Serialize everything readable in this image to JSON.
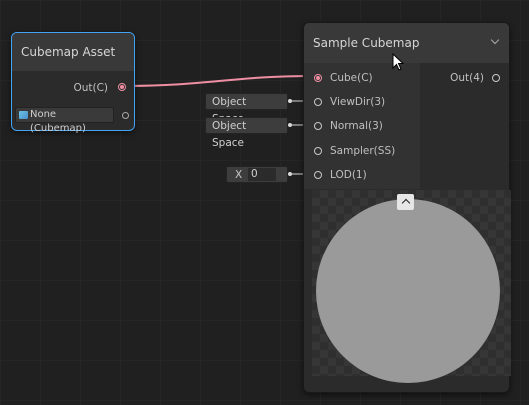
{
  "cubemap_asset_node": {
    "title": "Cubemap Asset",
    "output_label": "Out(C)",
    "field_value": "None (Cubemap)"
  },
  "sample_cubemap_node": {
    "title": "Sample Cubemap",
    "inputs": [
      "Cube(C)",
      "ViewDir(3)",
      "Normal(3)",
      "Sampler(SS)",
      "LOD(1)"
    ],
    "output_label": "Out(4)"
  },
  "inline_inputs": {
    "viewdir_value": "Object Space",
    "normal_value": "Object Space",
    "lod_axis": "X",
    "lod_value": "0"
  },
  "colors": {
    "selection": "#44a3f2",
    "cubemap_connection": "#ef8fa3",
    "background": "#202020"
  },
  "icons": [
    "cubemap-icon",
    "chevron-down-icon",
    "chevron-up-icon",
    "mouse-cursor-icon"
  ]
}
